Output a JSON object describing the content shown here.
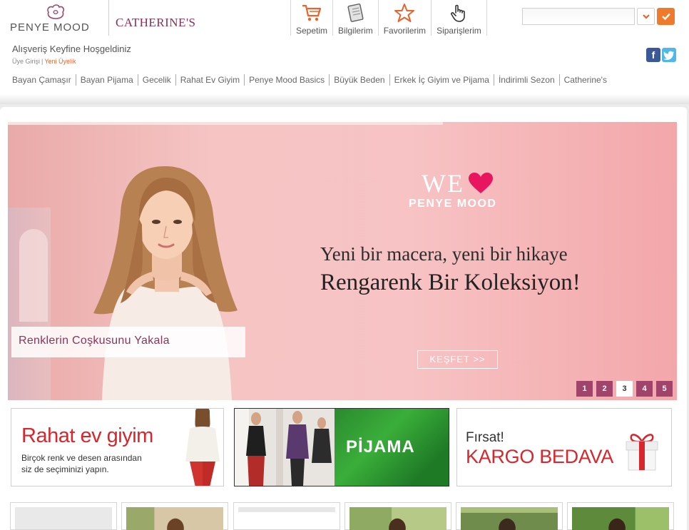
{
  "brand": {
    "logo_name": "PENYE MOOD",
    "second_logo": "CATHERINE'S"
  },
  "top_nav": [
    {
      "label": "Sepetim",
      "icon": "cart-icon"
    },
    {
      "label": "Bilgilerim",
      "icon": "notebook-icon"
    },
    {
      "label": "Favorilerim",
      "icon": "star-icon"
    },
    {
      "label": "Siparişlerim",
      "icon": "hand-cursor-icon"
    }
  ],
  "search": {
    "placeholder": "",
    "value": ""
  },
  "welcome": "Alışveriş Keyfine Hoşgeldiniz",
  "auth": {
    "login": "Üye Girişi",
    "separator": "|",
    "register": "Yeni Üyelik"
  },
  "social": {
    "facebook": "f"
  },
  "categories": [
    "Bayan Çamaşır",
    "Bayan Pijama",
    "Gecelik",
    "Rahat Ev Giyim",
    "Penye Mood Basics",
    "Büyük Beden",
    "Erkek İç Giyim ve Pijama",
    "İndirimli Sezon",
    "Catherine's"
  ],
  "slider": {
    "we": "WE",
    "brand": "PENYE MOOD",
    "line1": "Yeni bir macera, yeni bir hikaye",
    "line2": "Rengarenk Bir Koleksiyon!",
    "caption": "Renklerin Coşkusunu Yakala",
    "explore": "KEŞFET >>",
    "pages": [
      "1",
      "2",
      "3",
      "4",
      "5"
    ],
    "active_page": "3"
  },
  "promos": {
    "home_wear": {
      "title": "Rahat ev giyim",
      "sub1": "Birçok renk ve desen arasından",
      "sub2": "siz de seçiminizi yapın."
    },
    "pajama": {
      "title": "PİJAMA"
    },
    "shipping": {
      "line1": "Fırsat!",
      "line2": "KARGO BEDAVA"
    }
  },
  "colors": {
    "accent_orange": "#f07a2c",
    "brand_plum": "#8a2d5a",
    "promo_red": "#d8262d",
    "slider_dot": "#a0446c"
  }
}
